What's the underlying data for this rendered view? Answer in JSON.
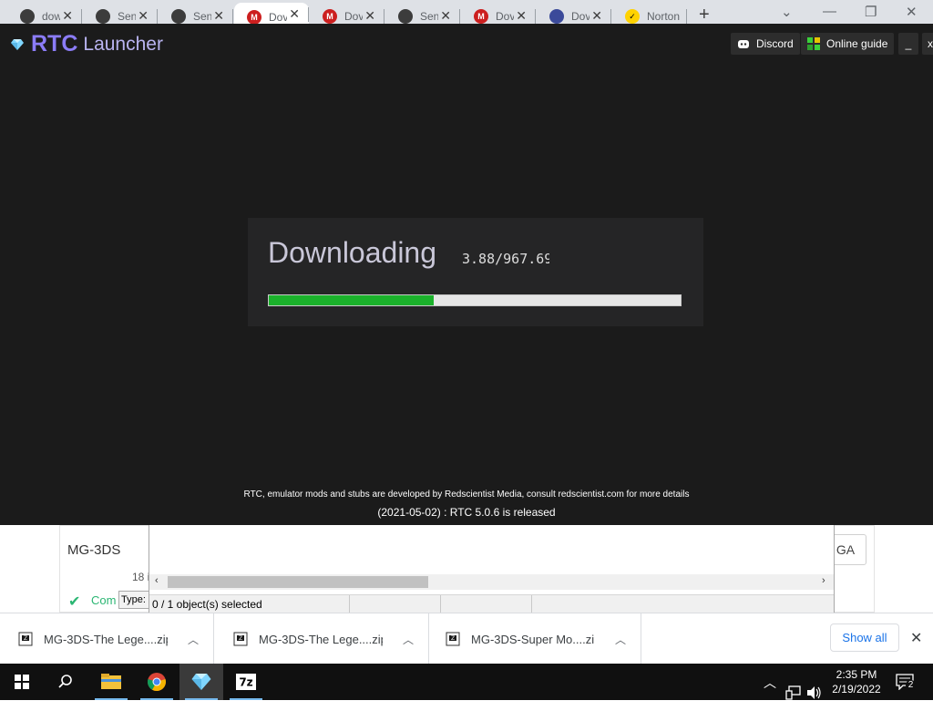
{
  "browser": {
    "tabs": [
      {
        "title": "dow",
        "fav_color": "#3c3c3c",
        "fav_glyph": "",
        "icon": "github-icon"
      },
      {
        "title": "Sen",
        "fav_color": "#3c3c3c",
        "fav_glyph": "",
        "icon": "search-engine-icon"
      },
      {
        "title": "Sen",
        "fav_color": "#3c3c3c",
        "fav_glyph": "",
        "icon": "search-engine-icon"
      },
      {
        "title": "Dov",
        "fav_color": "#cc1f1f",
        "fav_glyph": "M",
        "icon": "mega-icon"
      },
      {
        "title": "Dov",
        "fav_color": "#cc1f1f",
        "fav_glyph": "M",
        "icon": "mega-icon"
      },
      {
        "title": "Sen",
        "fav_color": "#3c3c3c",
        "fav_glyph": "",
        "icon": "search-engine-icon"
      },
      {
        "title": "Dov",
        "fav_color": "#cc1f1f",
        "fav_glyph": "M",
        "icon": "mega-icon"
      },
      {
        "title": "Dov",
        "fav_color": "#3b4a9a",
        "fav_glyph": "",
        "icon": "site-icon"
      },
      {
        "title": "Norton",
        "fav_color": "#ffd200",
        "fav_glyph": "✓",
        "icon": "norton-icon"
      }
    ],
    "new_tab": "+",
    "active_tab_index": 3
  },
  "app": {
    "name_rtc": "RTC",
    "name_launcher": "Launcher",
    "accent": "#8b7cf6",
    "buttons": {
      "discord": "Discord",
      "online_guide": "Online guide",
      "minimize": "_",
      "close": "x"
    },
    "download": {
      "title": "Downloading",
      "size_text": "3.88/967.69",
      "progress": 0.4,
      "progress_color": "#1bb12b"
    },
    "footer": {
      "credits": "RTC, emulator mods and stubs are developed by Redscientist Media, consult redscientist.com for more details",
      "news": "(2021-05-02) : RTC 5.0.6 is released"
    }
  },
  "background": {
    "card_title": "MG-3DS",
    "card_button": "GA",
    "item_count": "18 i",
    "status": "Com",
    "type_label": "Type:"
  },
  "sevenzip": {
    "status": "0 / 1 object(s) selected"
  },
  "downloads": {
    "items": [
      "MG-3DS-The Lege....zip",
      "MG-3DS-The Lege....zip",
      "MG-3DS-Super Mo....zip"
    ],
    "show_all": "Show all"
  },
  "taskbar": {
    "time": "2:35 PM",
    "date": "2/19/2022",
    "notification_count": "2"
  }
}
